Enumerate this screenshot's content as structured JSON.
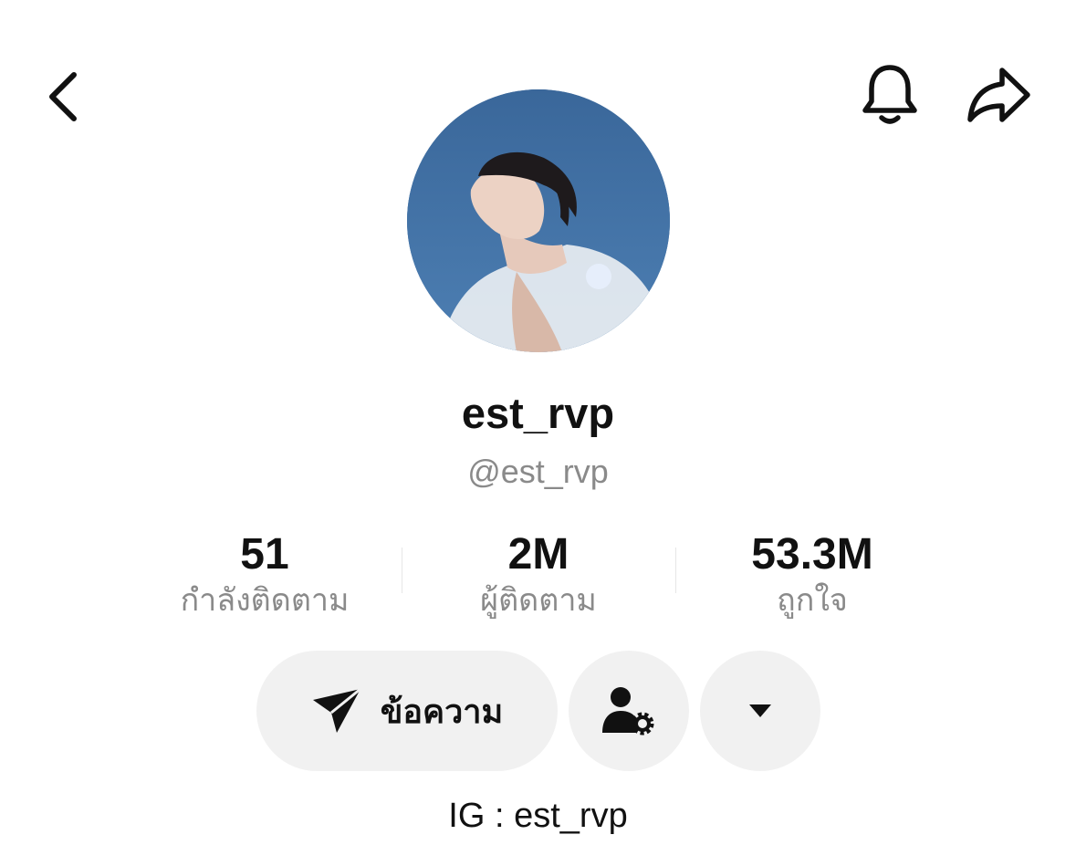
{
  "profile": {
    "display_name": "est_rvp",
    "handle": "@est_rvp",
    "bio": "IG : est_rvp"
  },
  "stats": [
    {
      "value": "51",
      "label": "กำลังติดตาม"
    },
    {
      "value": "2M",
      "label": "ผู้ติดตาม"
    },
    {
      "value": "53.3M",
      "label": "ถูกใจ"
    }
  ],
  "actions": {
    "message_label": "ข้อความ",
    "message_icon": "paper-plane-icon",
    "friend_icon": "user-settings-icon",
    "more_icon": "caret-down-icon"
  },
  "topbar": {
    "back_icon": "chevron-left-icon",
    "notify_icon": "bell-icon",
    "share_icon": "share-arrow-icon"
  },
  "colors": {
    "text_primary": "#111111",
    "text_secondary": "#8a8a8a",
    "button_bg": "#f1f1f1",
    "avatar_sky": "#3f6e9f"
  }
}
